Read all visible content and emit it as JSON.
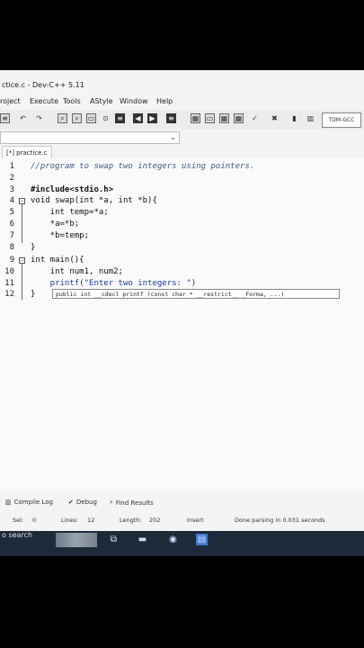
{
  "window": {
    "title": "ctice.c - Dev-C++ 5.11"
  },
  "menu": {
    "items": [
      "roject",
      "Execute",
      "Tools",
      "AStyle",
      "Window",
      "Help"
    ]
  },
  "toolbar": {
    "compiler": "TDM-GCC"
  },
  "tabs": {
    "active": "[*] practice.c"
  },
  "editor": {
    "lines": [
      {
        "n": "1",
        "text": "//program to swap two integers using pointers."
      },
      {
        "n": "2",
        "text": ""
      },
      {
        "n": "3",
        "text": "#include<stdio.h>"
      },
      {
        "n": "4",
        "text": "void swap(int *a, int *b){"
      },
      {
        "n": "5",
        "text": "    int temp=*a;"
      },
      {
        "n": "6",
        "text": "    *a=*b;"
      },
      {
        "n": "7",
        "text": "    *b=temp;"
      },
      {
        "n": "8",
        "text": "}"
      },
      {
        "n": "9",
        "text": "int main(){"
      },
      {
        "n": "10",
        "text": "    int num1, num2;"
      },
      {
        "n": "11",
        "text": "    printf(\"Enter two integers: \")"
      },
      {
        "n": "12",
        "text": "}"
      }
    ],
    "tooltip": "public int __cdecl printf (const char * __restrict__ _Forma, ...)"
  },
  "bottom_tabs": {
    "compile_log": "Compile Log",
    "debug": "Debug",
    "find_results": "Find Results"
  },
  "status": {
    "sel_label": "Sel:",
    "sel_value": "0",
    "lines_label": "Lines:",
    "lines_value": "12",
    "length_label": "Length:",
    "length_value": "202",
    "mode": "Insert",
    "message": "Done parsing in 0.031 seconds"
  },
  "taskbar": {
    "search": "o search"
  }
}
